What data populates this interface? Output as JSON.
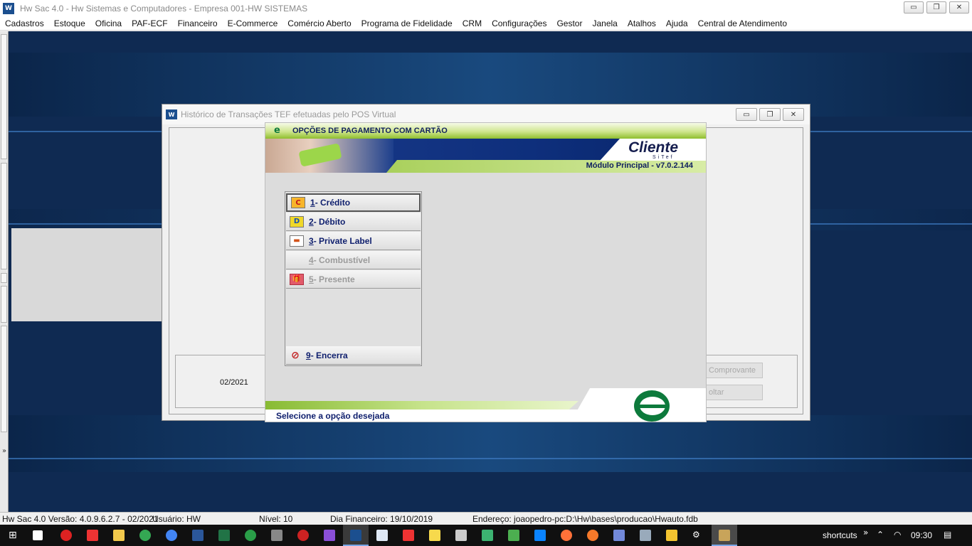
{
  "app": {
    "title": "Hw Sac 4.0 - Hw Sistemas e Computadores - Empresa 001-HW SISTEMAS",
    "icon_text": "W",
    "controls": {
      "minimize": "▭",
      "restore": "❐",
      "close": "✕"
    }
  },
  "menu": {
    "items": [
      "Cadastros",
      "Estoque",
      "Oficina",
      "PAF-ECF",
      "Financeiro",
      "E-Commerce",
      "Comércio Aberto",
      "Programa de Fidelidade",
      "CRM",
      "Configurações",
      "Gestor",
      "Janela",
      "Atalhos",
      "Ajuda",
      "Central de Atendimento"
    ]
  },
  "desktop": {
    "left_arrow": "»"
  },
  "history_window": {
    "title": "Histórico de Transações TEF efetuadas pelo POS Virtual",
    "icon_text": "W",
    "date": "02/2021",
    "buttons": {
      "comprovante": "Comprovante",
      "voltar": "oltar"
    }
  },
  "sitef": {
    "header_logo": "e",
    "header_title": "OPÇÕES DE PAGAMENTO COM CARTÃO",
    "brand": "Cliente",
    "brand_tag": "SiTef",
    "module_version": "Módulo Principal - v7.0.2.144",
    "options": [
      {
        "num": "1",
        "label": " - Crédito",
        "icon": "C",
        "icon_name": "credit-card-icon",
        "enabled": true,
        "selected": true
      },
      {
        "num": "2",
        "label": " - Débito",
        "icon": "D",
        "icon_name": "debit-card-icon",
        "enabled": true,
        "selected": false
      },
      {
        "num": "3",
        "label": " - Private Label",
        "icon": "▬",
        "icon_name": "private-label-card-icon",
        "enabled": true,
        "selected": false
      },
      {
        "num": "4",
        "label": " - Combustível",
        "icon": "",
        "icon_name": "fuel-icon",
        "enabled": false,
        "selected": false
      },
      {
        "num": "5",
        "label": " - Presente",
        "icon": "🎁",
        "icon_name": "gift-icon",
        "enabled": false,
        "selected": false
      }
    ],
    "exit_option": {
      "num": "9",
      "label": " - Encerra",
      "icon": "⊘"
    },
    "status": "Selecione a opção desejada"
  },
  "statusbar": {
    "version": "Hw Sac 4.0 Versão: 4.0.9.6.2.7 - 02/2021",
    "user": "Usuário: HW",
    "level": "Nível: 10",
    "financial_day": "Dia Financeiro: 19/10/2019",
    "address": "Endereço: joaopedro-pc:D:\\Hw\\bases\\producao\\Hwauto.fdb"
  },
  "taskbar": {
    "shortcuts_label": "shortcuts",
    "chevron": "»",
    "tray_up": "⌃",
    "clock": "09:30"
  },
  "colors": {
    "desktop_bg": "#0f2a52",
    "sitef_green": "#8fbe2d",
    "sitef_navy": "#10206e"
  }
}
